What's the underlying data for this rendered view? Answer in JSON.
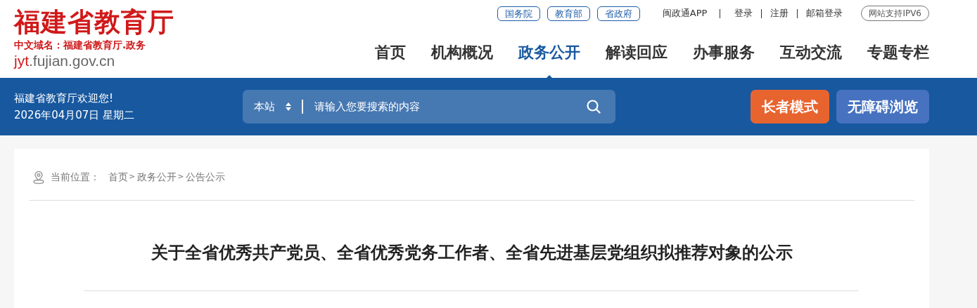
{
  "logo": {
    "title": "福建省教育厅",
    "subtitle": "中文域名：福建省教育厅.政务",
    "domain_highlight": "jyt",
    "domain_rest": ".fujian.gov.cn"
  },
  "top_links": [
    {
      "label": "国务院",
      "kind": "outlined"
    },
    {
      "label": "教育部",
      "kind": "outlined"
    },
    {
      "label": "省政府",
      "kind": "outlined"
    }
  ],
  "account_links": [
    "闽政通APP",
    "登录",
    "注册",
    "邮箱登录"
  ],
  "ipv6_badge": "网站支持IPV6",
  "nav": [
    {
      "label": "首页",
      "selected": false
    },
    {
      "label": "机构概况",
      "selected": false
    },
    {
      "label": "政务公开",
      "selected": true
    },
    {
      "label": "解读回应",
      "selected": false
    },
    {
      "label": "办事服务",
      "selected": false
    },
    {
      "label": "互动交流",
      "selected": false
    },
    {
      "label": "专题专栏",
      "selected": false
    }
  ],
  "banner": {
    "welcome": "福建省教育厅欢迎您!",
    "date": "2026年04月07日 星期二"
  },
  "search": {
    "scope": "本站",
    "placeholder": "请输入您要搜索的内容"
  },
  "mode_buttons": [
    {
      "label": "长者模式",
      "kind": "elder"
    },
    {
      "label": "无障碍浏览",
      "kind": "accessible"
    }
  ],
  "breadcrumb": {
    "label": "当前位置：",
    "separator": ">",
    "items": [
      "首页",
      "政务公开",
      "公告公示"
    ]
  },
  "article": {
    "title": "关于全省优秀共产党员、全省优秀党务工作者、全省先进基层党组织拟推荐对象的公示"
  }
}
